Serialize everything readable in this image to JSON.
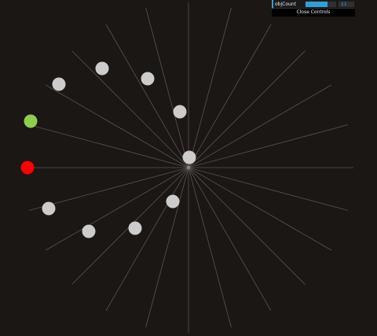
{
  "controls": {
    "obj_count_label": "objCount",
    "obj_count_value": "11",
    "obj_count_fraction": 0.72,
    "close_label": "Close Controls"
  },
  "scene": {
    "ray_count": 24,
    "balls": [
      {
        "name": "ball-red",
        "color": "#ff0000"
      },
      {
        "name": "ball-green",
        "color": "#8fce4a"
      },
      {
        "name": "ball-white",
        "color": "#cccccc"
      }
    ]
  },
  "colors": {
    "background": "#1b1714",
    "ray": "#5a5450",
    "ball_default": "#cccccc",
    "accent": "#2fa1d6"
  }
}
